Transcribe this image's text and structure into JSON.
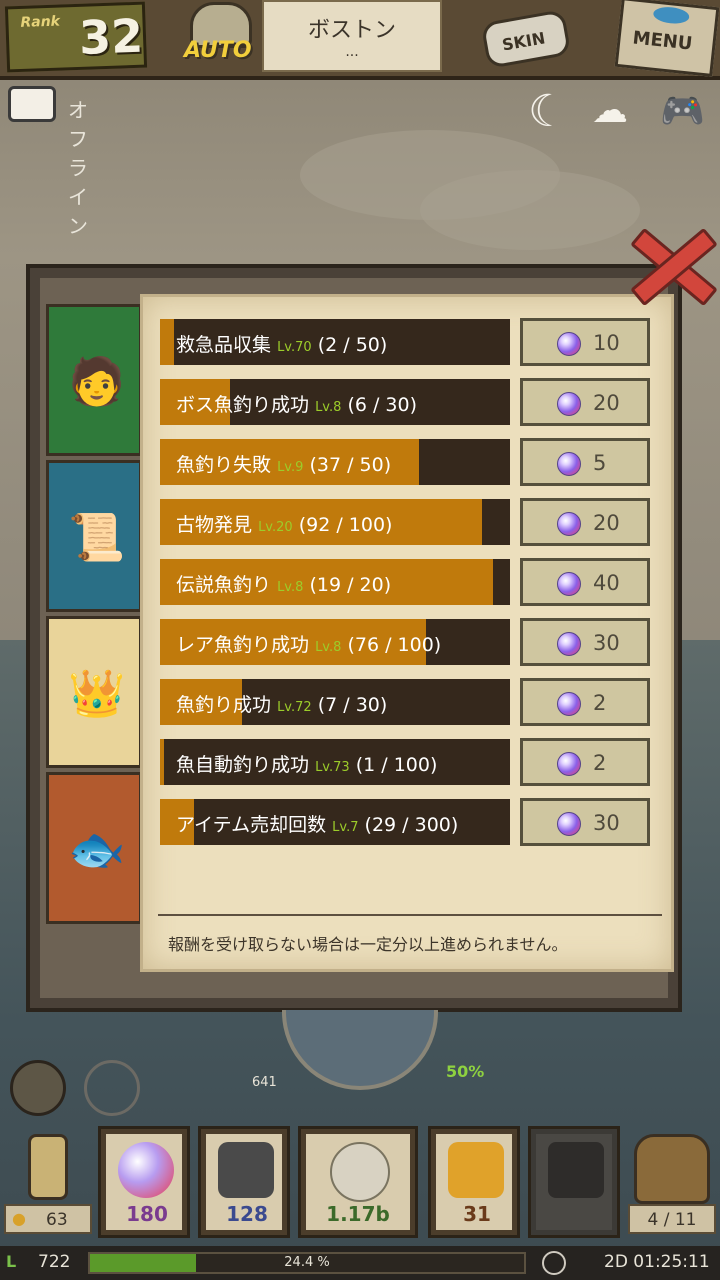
{
  "header": {
    "rank_label": "Rank",
    "rank_value": "32",
    "auto_label": "AUTO",
    "location": "ボストン",
    "location_sub": "...",
    "skin_label": "SKIN",
    "menu_label": "MENU"
  },
  "status": {
    "offline_label": "オフライン",
    "icons": [
      "chat-icon",
      "moon-icon",
      "cloud-upload-icon",
      "gamepad-icon"
    ]
  },
  "tabs": [
    {
      "name": "character",
      "icon": "character-icon",
      "color": "#2f7a3a"
    },
    {
      "name": "quest",
      "icon": "scroll-icon",
      "color": "#2a6f86"
    },
    {
      "name": "achievement",
      "icon": "crown-icon",
      "color": "#e9d49a"
    },
    {
      "name": "fish",
      "icon": "fish-icon",
      "color": "#b25a2e"
    }
  ],
  "quests": [
    {
      "title": "救急品収集",
      "level": "Lv.70",
      "progress": "(2 / 50)",
      "fraction": 0.04,
      "reward": "10"
    },
    {
      "title": "ボス魚釣り成功",
      "level": "Lv.8",
      "progress": "(6 / 30)",
      "fraction": 0.2,
      "reward": "20"
    },
    {
      "title": "魚釣り失敗",
      "level": "Lv.9",
      "progress": "(37 / 50)",
      "fraction": 0.74,
      "reward": "5"
    },
    {
      "title": "古物発見",
      "level": "Lv.20",
      "progress": "(92 / 100)",
      "fraction": 0.92,
      "reward": "20"
    },
    {
      "title": "伝説魚釣り",
      "level": "Lv.8",
      "progress": "(19 / 20)",
      "fraction": 0.95,
      "reward": "40"
    },
    {
      "title": "レア魚釣り成功",
      "level": "Lv.8",
      "progress": "(76 / 100)",
      "fraction": 0.76,
      "reward": "30"
    },
    {
      "title": "魚釣り成功",
      "level": "Lv.72",
      "progress": "(7 / 30)",
      "fraction": 0.233,
      "reward": "2"
    },
    {
      "title": "魚自動釣り成功",
      "level": "Lv.73",
      "progress": "(1 / 100)",
      "fraction": 0.01,
      "reward": "2"
    },
    {
      "title": "アイテム売却回数",
      "level": "Lv.7",
      "progress": "(29 / 300)",
      "fraction": 0.097,
      "reward": "30"
    }
  ],
  "notice": "報酬を受け取らない場合は一定分以上進められません。",
  "hud": {
    "lantern_count": "63",
    "items": [
      {
        "name": "gem",
        "value": "180",
        "color": "#7a3b8f"
      },
      {
        "name": "web",
        "value": "128",
        "color": "#3b4a8f"
      },
      {
        "name": "shell",
        "value": "1.17b",
        "color": "#3b6a2a"
      },
      {
        "name": "amber",
        "value": "31",
        "color": "#6a3a1a"
      }
    ],
    "bag_count": "4 / 11",
    "level": "722",
    "xp_percent": "24.4 %",
    "xp_fraction": 0.244,
    "timer": "2D 01:25:11",
    "gauge_value": "641",
    "boost_label": "50%"
  }
}
